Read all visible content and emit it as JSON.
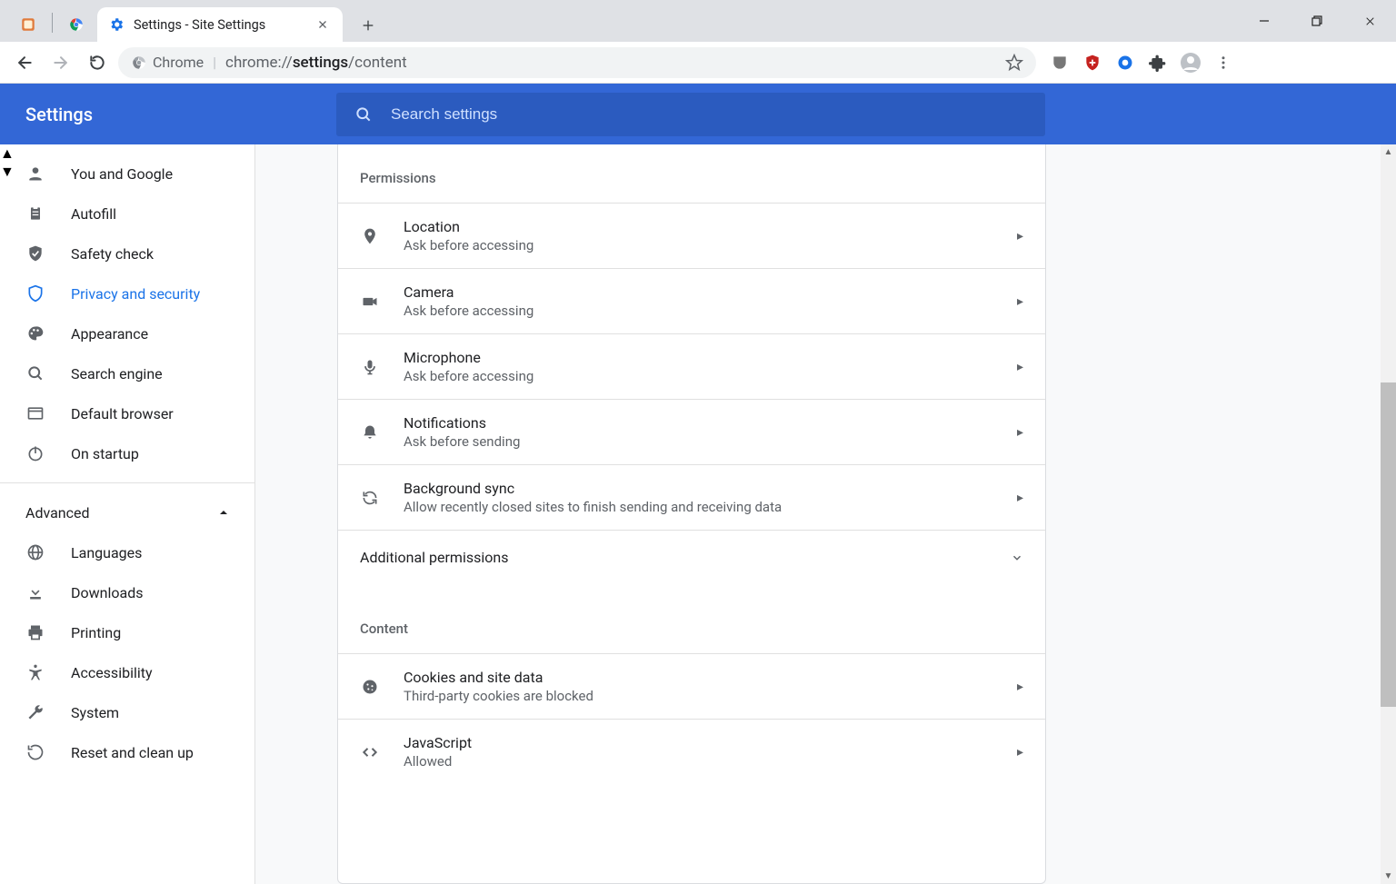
{
  "window": {
    "tab_title": "Settings - Site Settings"
  },
  "omnibox": {
    "origin_label": "Chrome",
    "url_prefix": "chrome://",
    "url_strong": "settings",
    "url_suffix": "/content"
  },
  "ribbon": {
    "title": "Settings",
    "search_placeholder": "Search settings"
  },
  "sidebar": {
    "items_top": [
      {
        "label": "You and Google"
      },
      {
        "label": "Autofill"
      },
      {
        "label": "Safety check"
      },
      {
        "label": "Privacy and security"
      },
      {
        "label": "Appearance"
      },
      {
        "label": "Search engine"
      },
      {
        "label": "Default browser"
      },
      {
        "label": "On startup"
      }
    ],
    "advanced_label": "Advanced",
    "items_adv": [
      {
        "label": "Languages"
      },
      {
        "label": "Downloads"
      },
      {
        "label": "Printing"
      },
      {
        "label": "Accessibility"
      },
      {
        "label": "System"
      },
      {
        "label": "Reset and clean up"
      }
    ]
  },
  "content": {
    "permissions_header": "Permissions",
    "permissions": [
      {
        "title": "Location",
        "sub": "Ask before accessing"
      },
      {
        "title": "Camera",
        "sub": "Ask before accessing"
      },
      {
        "title": "Microphone",
        "sub": "Ask before accessing"
      },
      {
        "title": "Notifications",
        "sub": "Ask before sending"
      },
      {
        "title": "Background sync",
        "sub": "Allow recently closed sites to finish sending and receiving data"
      }
    ],
    "additional_permissions_label": "Additional permissions",
    "content_header": "Content",
    "content_rows": [
      {
        "title": "Cookies and site data",
        "sub": "Third-party cookies are blocked"
      },
      {
        "title": "JavaScript",
        "sub": "Allowed"
      }
    ]
  }
}
